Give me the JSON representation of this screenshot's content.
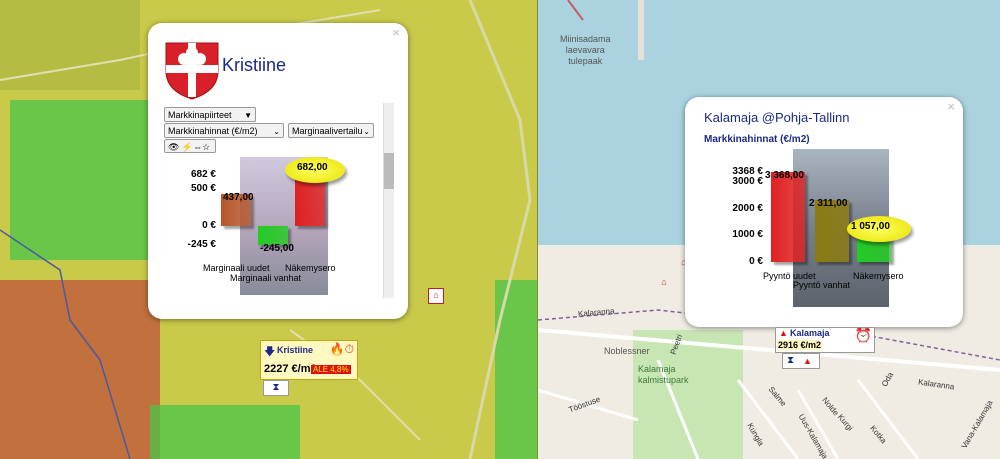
{
  "left_popup": {
    "title": "Kristiine",
    "close": "×",
    "dropdown_main": "Markkinapiirteet",
    "dropdown_a": "Markkinahinnat (€/m2)",
    "dropdown_b": "Marginaalivertailu",
    "tool_icons": "👁 ⚡⇔☆",
    "chart_data": {
      "type": "bar",
      "categories": [
        "Marginaali uudet",
        "Marginaali vanhat",
        "Näkemysero"
      ],
      "values": [
        437.0,
        -245.0,
        682.0
      ],
      "value_labels": [
        "437,00",
        "-245,00",
        "682,00"
      ],
      "y_tick_labels": [
        "682 €",
        "500 €",
        "0 €",
        "-245 €"
      ],
      "y_ticks": [
        682,
        500,
        0,
        -245
      ],
      "ylim": [
        -245,
        682
      ],
      "colors": [
        "#b5562a",
        "#22cc22",
        "#e02020"
      ],
      "highlight_index": 2
    }
  },
  "left_marker": {
    "name": "Kristiine",
    "price": "2227 €/m2",
    "badge": "ALE 4,8%",
    "icons": "🔥⏱",
    "hourglass": "⧗"
  },
  "right_popup": {
    "title": "Kalamaja @Pohja-Tallinn",
    "subtitle": "Markkinahinnat (€/m2)",
    "close": "×",
    "chart_data": {
      "type": "bar",
      "categories": [
        "Pyyntö uudet",
        "Pyyntö vanhat",
        "Näkemysero"
      ],
      "values": [
        3368.0,
        2311.0,
        1057.0
      ],
      "value_labels": [
        "3 368,00",
        "2 311,00",
        "1 057,00"
      ],
      "y_tick_labels": [
        "3368 €",
        "3000 €",
        "2000 €",
        "1000 €",
        "0 €"
      ],
      "y_ticks": [
        3368,
        3000,
        2000,
        1000,
        0
      ],
      "ylim": [
        0,
        3368
      ],
      "colors": [
        "#e02020",
        "#8a7a10",
        "#22cc22"
      ],
      "highlight_index": 2
    }
  },
  "right_marker": {
    "name": "Kalamaja",
    "price": "2916 €/m2",
    "hourglass": "⧗",
    "alarm": "⏰"
  },
  "map_labels": {
    "harbor": "Miinisadama\nlaevavara\ntulepaak",
    "noblessner": "Noblessner",
    "park": "Kalamaja\nkalmistupark",
    "kalaranna1": "Kalaranna",
    "kalaranna2": "Kalaranna",
    "tööstuse": "Tööstuse",
    "salme": "Salme",
    "kungla": "Kungla",
    "oda": "Oda",
    "kotka": "Kotka",
    "kurgi": "Kurgi",
    "nolde": "Nolde",
    "uus_kalamaja": "Uus-Kalamaja",
    "peetri": "Peetri",
    "vana_kalamaja": "Vana-Kalamaja"
  }
}
